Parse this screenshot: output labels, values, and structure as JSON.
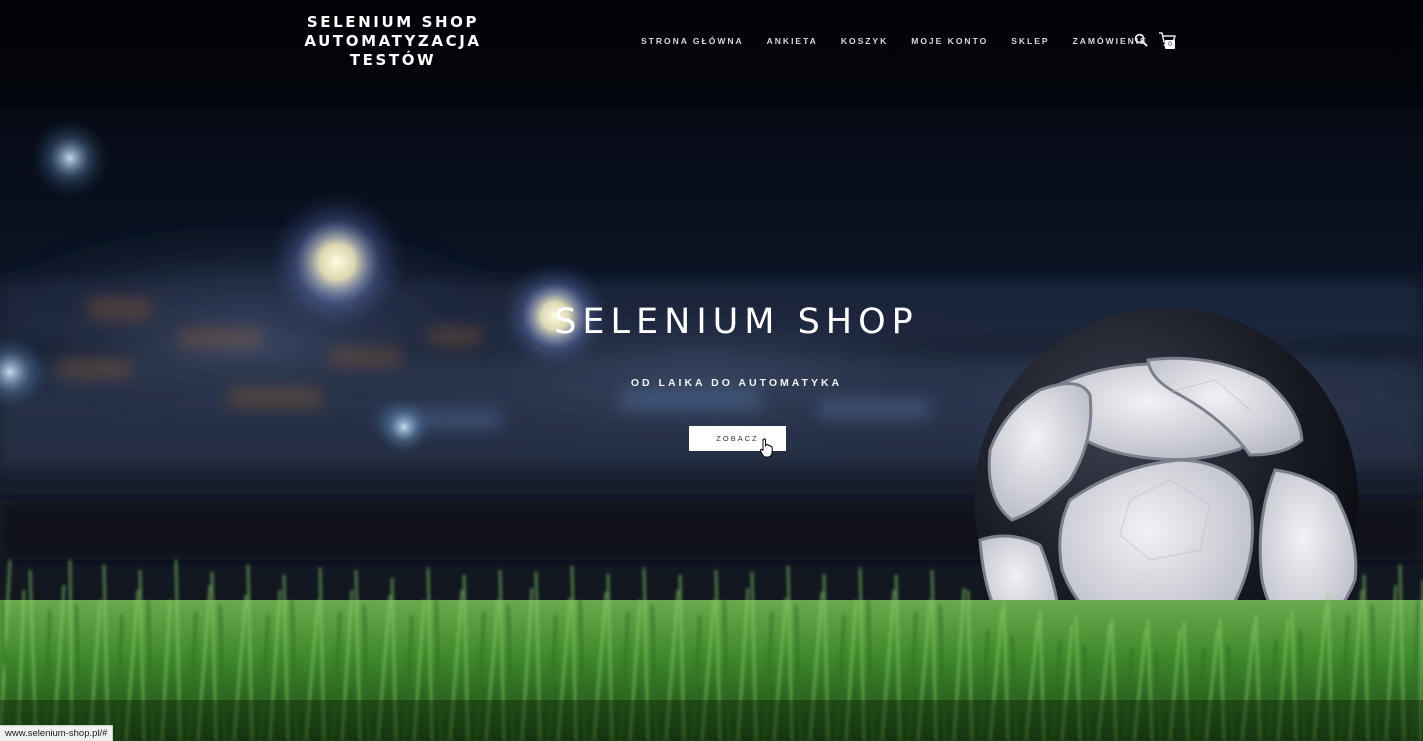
{
  "site": {
    "title_lines": [
      "SELENIUM SHOP",
      "AUTOMATYZACJA",
      "TESTÓW"
    ]
  },
  "nav": {
    "items": [
      {
        "label": "STRONA GŁÓWNA",
        "name": "nav-item-home"
      },
      {
        "label": "ANKIETA",
        "name": "nav-item-survey"
      },
      {
        "label": "KOSZYK",
        "name": "nav-item-cart"
      },
      {
        "label": "MOJE KONTO",
        "name": "nav-item-account"
      },
      {
        "label": "SKLEP",
        "name": "nav-item-shop"
      },
      {
        "label": "ZAMÓWIENIE",
        "name": "nav-item-order"
      }
    ],
    "search_icon": "search-icon",
    "cart_icon": "cart-icon",
    "cart_count": "0"
  },
  "hero": {
    "title": "SELENIUM SHOP",
    "subtitle": "OD LAIKA DO AUTOMATYKA",
    "cta_label": "ZOBACZ",
    "background": "stadium-football-image"
  },
  "status_bar": {
    "url": "www.selenium-shop.pl/#"
  },
  "colors": {
    "background": "#05070d",
    "text": "#ffffff",
    "button_bg": "#ffffff",
    "button_text": "#333333",
    "grass": "#3f8a2c"
  }
}
